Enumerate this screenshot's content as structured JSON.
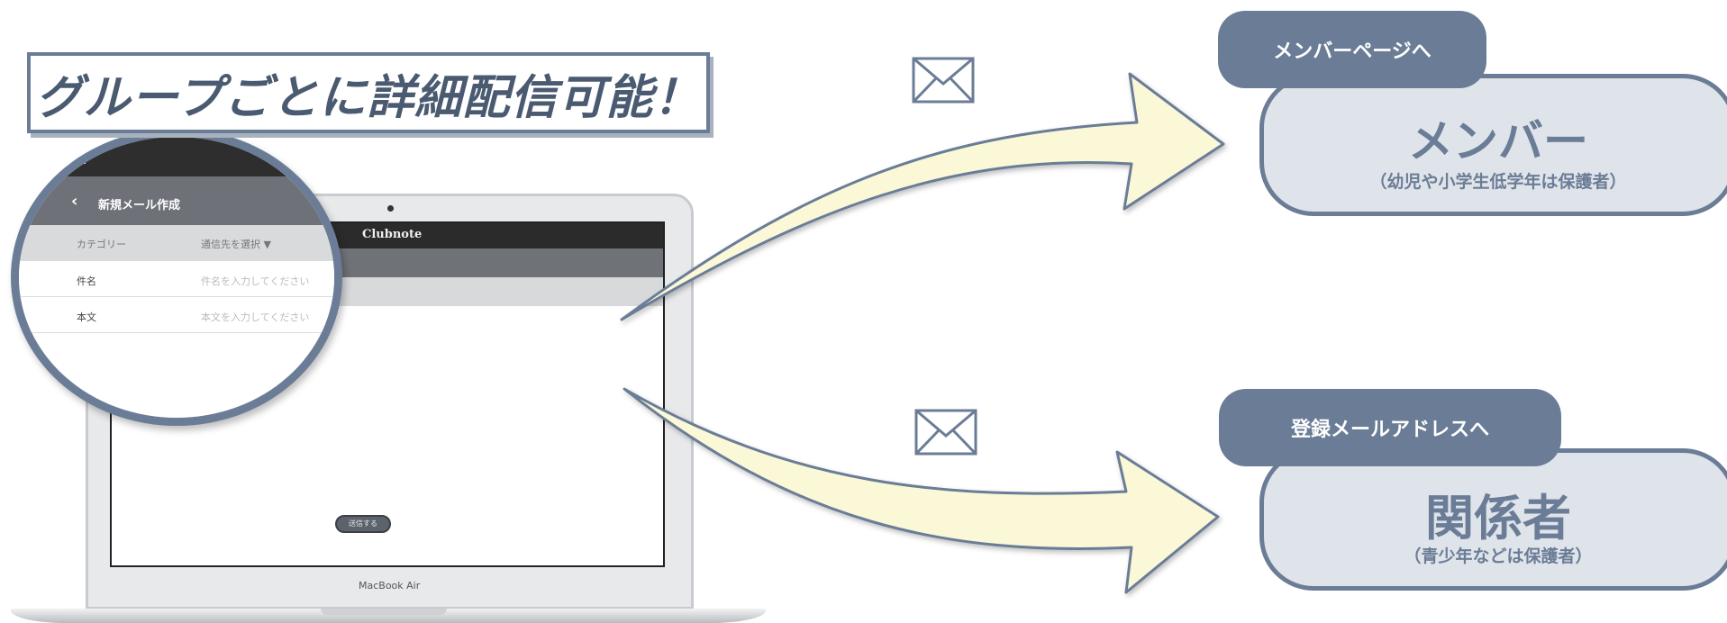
{
  "banner": {
    "title": "グループごとに詳細配信可能！"
  },
  "app_screen": {
    "brand": "Clubnote",
    "send_button": "送信する"
  },
  "laptop": {
    "model_label": "MacBook Air"
  },
  "magnifier": {
    "menu_icon": "hamburger-menu-icon",
    "back_icon": "chevron-left-icon",
    "title": "新規メール作成",
    "category_label": "カテゴリー",
    "recipient_select": "通信先を選択 ▼",
    "rows": [
      {
        "label": "件名",
        "placeholder": "件名を入力してください"
      },
      {
        "label": "本文",
        "placeholder": "本文を入力してください"
      }
    ]
  },
  "destinations": [
    {
      "tag": "メンバーページへ",
      "name": "メンバー",
      "note": "（幼児や小学生低学年は保護者）",
      "icon": "envelope-icon"
    },
    {
      "tag": "登録メールアドレスへ",
      "name": "関係者",
      "note": "（青少年などは保護者）",
      "icon": "envelope-icon"
    }
  ],
  "colors": {
    "accent": "#6b7d96",
    "card_fill": "#dfe3ea",
    "arrow_fill": "#fbf8d8"
  }
}
